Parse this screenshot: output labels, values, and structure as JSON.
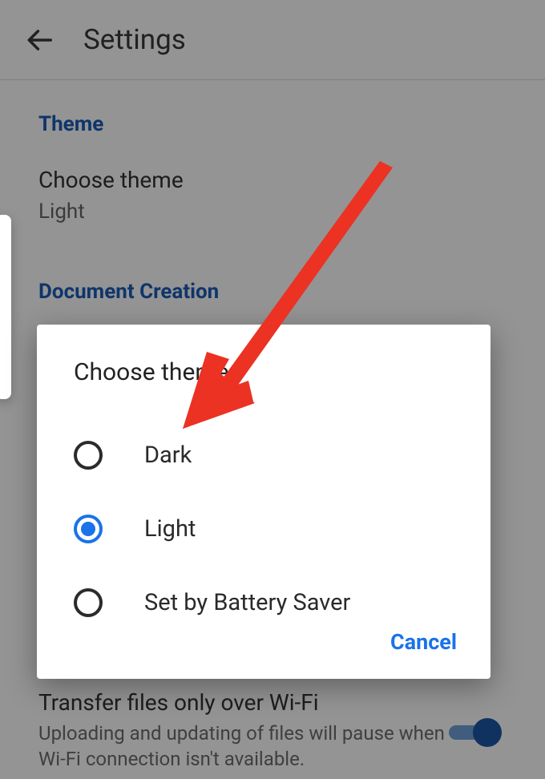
{
  "header": {
    "title": "Settings"
  },
  "sections": {
    "theme": {
      "header": "Theme",
      "item_title": "Choose theme",
      "item_value": "Light"
    },
    "document_creation": {
      "header": "Document Creation"
    },
    "wifi": {
      "title": "Transfer files only over Wi-Fi",
      "subtitle": "Uploading and updating of files will pause when Wi-Fi connection isn't available.",
      "enabled": true
    }
  },
  "dialog": {
    "title": "Choose theme",
    "options": [
      {
        "label": "Dark",
        "selected": false
      },
      {
        "label": "Light",
        "selected": true
      },
      {
        "label": "Set by Battery Saver",
        "selected": false
      }
    ],
    "cancel_label": "Cancel"
  },
  "colors": {
    "accent": "#1a73e8",
    "section_header": "#1b5cb8",
    "annotation": "#eb3223"
  }
}
